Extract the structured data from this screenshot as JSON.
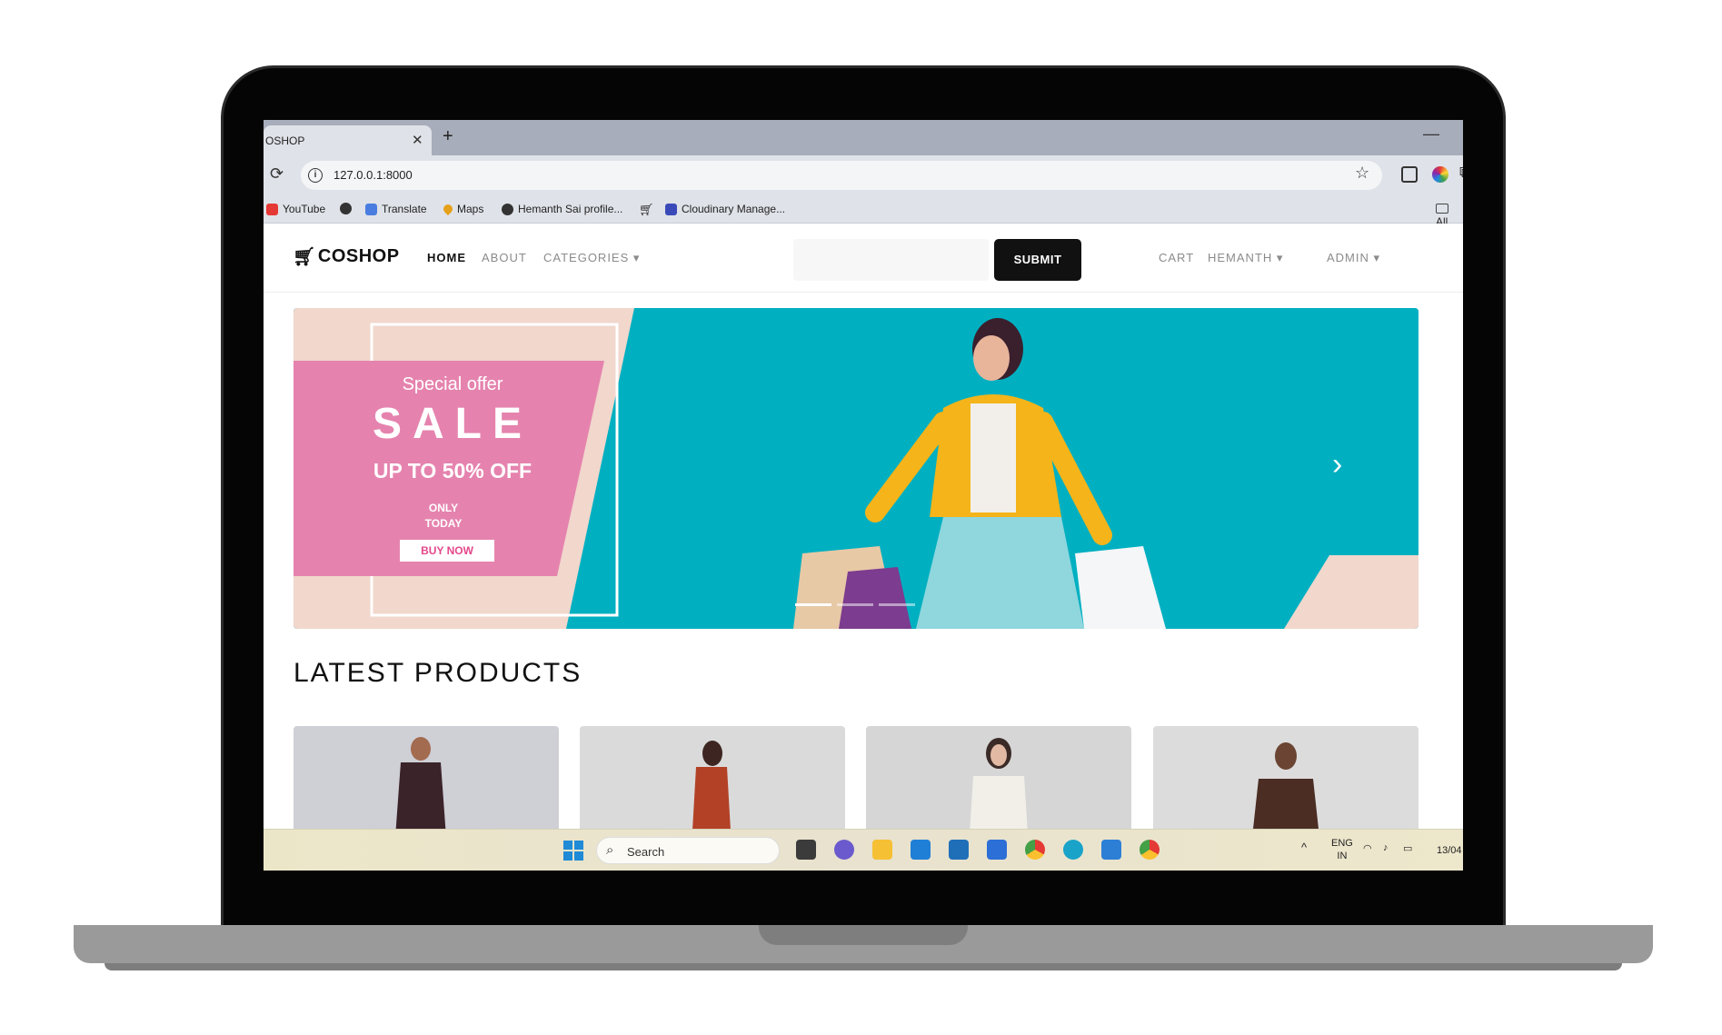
{
  "browser": {
    "tab_title": "OSHOP",
    "tab_close": "✕",
    "new_tab": "+",
    "minimize": "—",
    "url": "127.0.0.1:8000",
    "bookmarks": [
      "YouTube",
      "Translate",
      "Maps",
      "Hemanth Sai profile...",
      "Cloudinary Manage..."
    ],
    "all_bookmarks": "All"
  },
  "site": {
    "brand": "COSHOP",
    "nav": {
      "home": "HOME",
      "about": "ABOUT",
      "categories": "CATEGORIES ▾",
      "cart": "CART",
      "user": "HEMANTH ▾",
      "admin": "ADMIN ▾"
    },
    "search": {
      "placeholder": "",
      "submit": "SUBMIT"
    },
    "hero": {
      "special": "Special offer",
      "sale": "SALE",
      "upto": "UP TO 50% OFF",
      "only": "ONLY",
      "today": "TODAY",
      "buy_now": "BUY NOW",
      "next": "›"
    },
    "section_title": "LATEST PRODUCTS"
  },
  "taskbar": {
    "search": "Search",
    "lang1": "ENG",
    "lang2": "IN",
    "clock": "13/04",
    "tray_chevron": "^"
  },
  "colors": {
    "hero_teal": "#00b0c1",
    "hero_pink": "#e583ae",
    "hero_beige": "#f1d7cc",
    "submit_bg": "#111111"
  }
}
